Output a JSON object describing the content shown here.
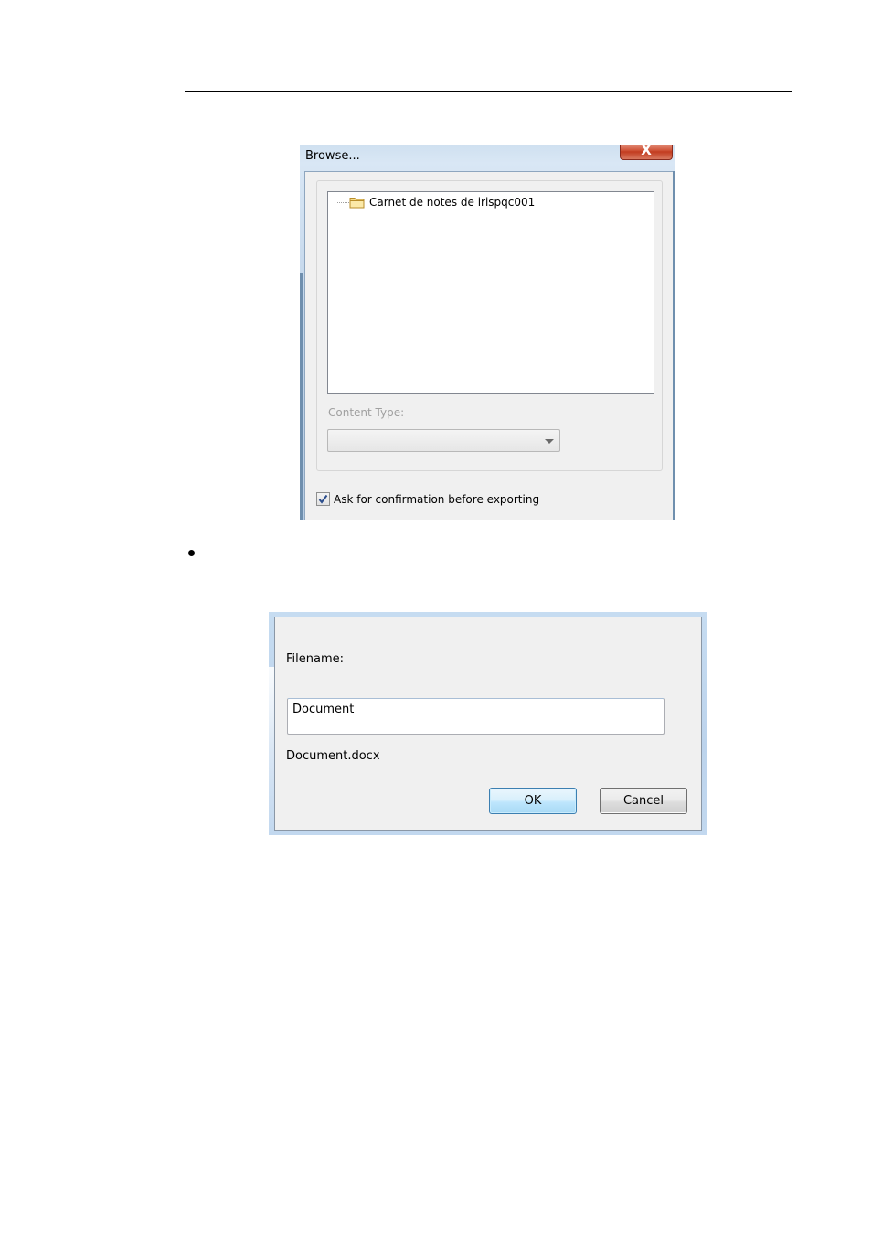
{
  "browse_dialog": {
    "title": "Browse...",
    "close_glyph": "X",
    "tree": {
      "items": [
        {
          "label": "Carnet de notes de irispqc001",
          "icon": "folder-icon"
        }
      ]
    },
    "content_type_label": "Content Type:",
    "content_type_value": "",
    "confirm_checkbox": {
      "label": "Ask for confirmation before exporting",
      "checked": true
    }
  },
  "filename_dialog": {
    "label": "Filename:",
    "input_value": "Document",
    "preview": "Document.docx",
    "ok_label": "OK",
    "cancel_label": "Cancel"
  }
}
